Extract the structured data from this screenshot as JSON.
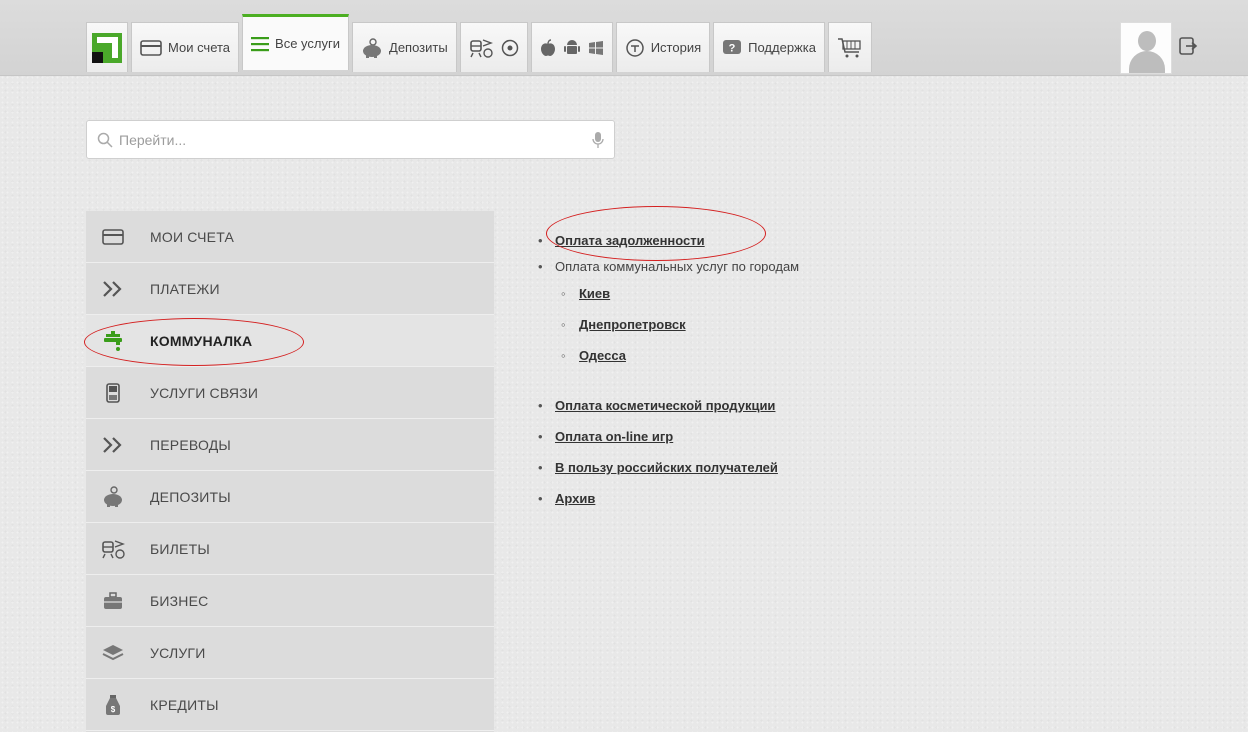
{
  "nav": {
    "tabs": [
      {
        "label": "Мои счета",
        "icon": "card-icon"
      },
      {
        "label": "Все услуги",
        "icon": "list-icon",
        "active": true
      },
      {
        "label": "Депозиты",
        "icon": "piggy-bank-icon"
      },
      {
        "label": "История",
        "icon": "history-icon"
      },
      {
        "label": "Поддержка",
        "icon": "help-icon"
      }
    ]
  },
  "search": {
    "placeholder": "Перейти..."
  },
  "sidebar": {
    "items": [
      {
        "label": "МОИ СЧЕТА",
        "icon": "card-icon"
      },
      {
        "label": "ПЛАТЕЖИ",
        "icon": "chevrons-icon"
      },
      {
        "label": "КОММУНАЛКА",
        "icon": "faucet-icon",
        "active": true
      },
      {
        "label": "УСЛУГИ СВЯЗИ",
        "icon": "phone-icon"
      },
      {
        "label": "ПЕРЕВОДЫ",
        "icon": "chevrons-icon"
      },
      {
        "label": "ДЕПОЗИТЫ",
        "icon": "piggy-bank-icon"
      },
      {
        "label": "БИЛЕТЫ",
        "icon": "tickets-icon"
      },
      {
        "label": "БИЗНЕС",
        "icon": "briefcase-icon"
      },
      {
        "label": "УСЛУГИ",
        "icon": "layers-icon"
      },
      {
        "label": "КРЕДИТЫ",
        "icon": "money-bag-icon"
      }
    ]
  },
  "content": {
    "debt_payment": "Оплата задолженности",
    "utilities_by_city": "Оплата коммунальных услуг по городам",
    "cities": [
      "Киев",
      "Днепропетровск",
      "Одесса"
    ],
    "links": [
      "Оплата косметической продукции",
      "Оплата on-line игр",
      "В пользу российских получателей",
      "Архив"
    ]
  },
  "colors": {
    "accent": "#4caf22",
    "annotation": "#d42020"
  }
}
